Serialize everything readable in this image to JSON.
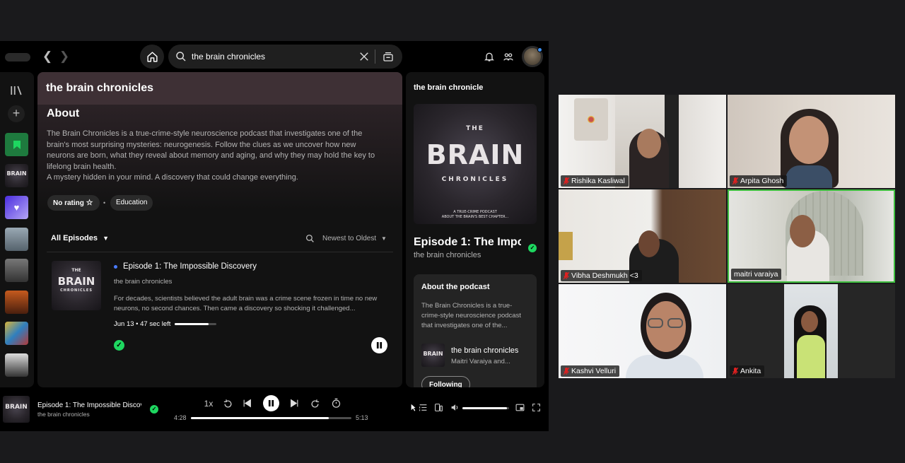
{
  "search": {
    "query": "the brain chronicles"
  },
  "main": {
    "header_title": "the brain chronicles",
    "about_heading": "About",
    "about_lines": [
      "The Brain Chronicles is a true-crime-style neuroscience podcast that investigates one of the",
      "brain's most surprising mysteries: neurogenesis. Follow the clues as we uncover how new",
      "neurons are born, what they reveal about memory and aging, and why they may hold the key to",
      "lifelong brain health.",
      "A mystery hidden in your mind. A discovery that could change everything."
    ],
    "rating_label": "No rating",
    "category_label": "Education",
    "episodes_filter": "All Episodes",
    "sort_label": "Newest to Oldest",
    "episode": {
      "title": "Episode 1: The Impossible Discovery",
      "show": "the brain chronicles",
      "desc_lines": [
        "For decades, scientists believed the adult brain was a crime scene frozen in time no new",
        "neurons, no second chances. Then came a discovery so shocking it challenged..."
      ],
      "meta": "Jun 13 • 47 sec left",
      "progress": 0.82
    }
  },
  "right_panel": {
    "title": "the brain chronicle",
    "art": {
      "the": "THE",
      "brain": "BRAIN",
      "chronicles": "CHRONICLES",
      "tag1": "A TRUE-CRIME PODCAST",
      "tag2": "ABOUT THE BRAIN'S BEST CHAPTER..."
    },
    "episode_title": "Episode 1: The Impo",
    "show_name": "the brain chronicles",
    "about_heading": "About the podcast",
    "about_lines": [
      "The Brain Chronicles is a true-",
      "crime-style neuroscience podcast",
      "that investigates one of the..."
    ],
    "creator_show": "the brain chronicles",
    "creator_names": "Maitri Varaiya and...",
    "following_label": "Following"
  },
  "player": {
    "title": "Episode 1: The Impossible Discove",
    "show": "the brain chronicles",
    "speed": "1x",
    "elapsed": "4:28",
    "total": "5:13",
    "progress": 0.86,
    "volume": 0.95,
    "art_text": "BRAIN"
  },
  "participants": [
    {
      "name": "Rishika Kasliwal",
      "muted": true
    },
    {
      "name": "Arpita Ghosh",
      "muted": true
    },
    {
      "name": "Vibha Deshmukh <3",
      "muted": true
    },
    {
      "name": "maitri varaiya",
      "muted": false
    },
    {
      "name": "Kashvi Velluri",
      "muted": true
    },
    {
      "name": "Ankita",
      "muted": true
    }
  ],
  "colors": {
    "spotify_green": "#1ed760",
    "active_speaker_border": "#3fbf3f",
    "muted_red": "#e02020",
    "header_mauve": "#3e3035",
    "unplayed_dot": "#4a7cff"
  }
}
